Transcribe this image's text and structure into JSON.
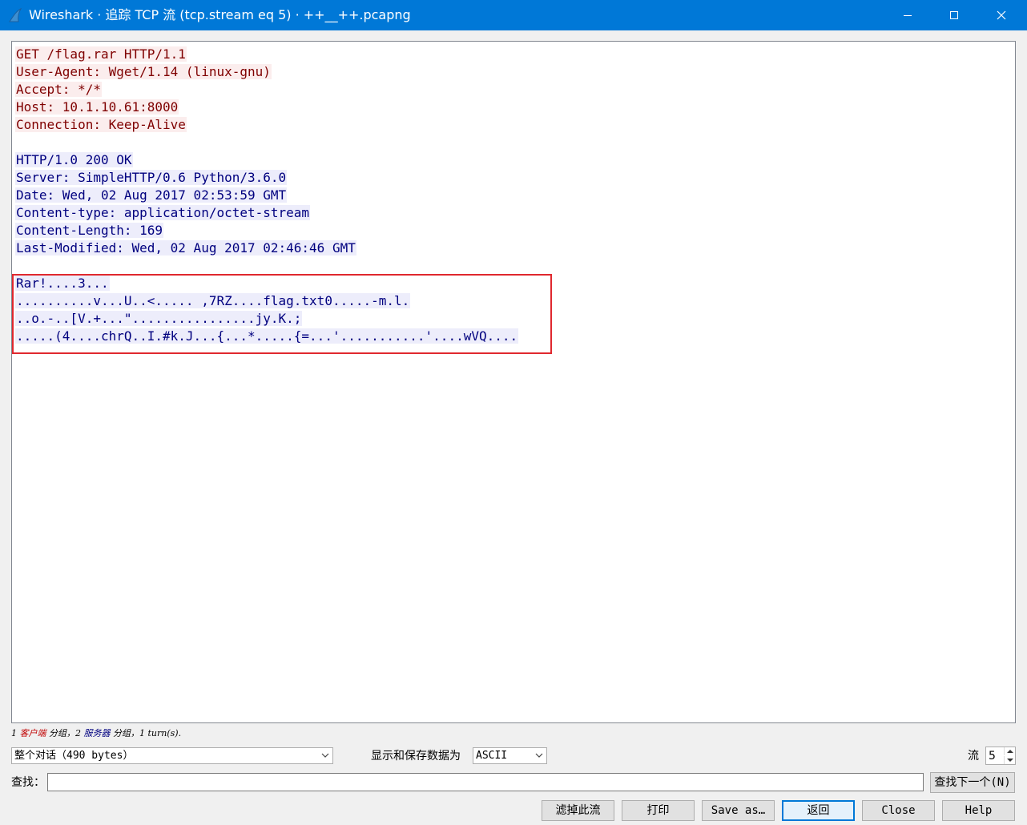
{
  "window": {
    "title": "Wireshark · 追踪 TCP 流 (tcp.stream eq 5) · ++__++.pcapng",
    "icon": "wireshark-fin-icon",
    "controls": [
      "minimize-icon",
      "maximize-icon",
      "close-icon"
    ]
  },
  "stream": {
    "client_lines": [
      "GET /flag.rar HTTP/1.1",
      "User-Agent: Wget/1.14 (linux-gnu)",
      "Accept: */*",
      "Host: 10.1.10.61:8000",
      "Connection: Keep-Alive"
    ],
    "server_header_lines": [
      "HTTP/1.0 200 OK",
      "Server: SimpleHTTP/0.6 Python/3.6.0",
      "Date: Wed, 02 Aug 2017 02:53:59 GMT",
      "Content-type: application/octet-stream",
      "Content-Length: 169",
      "Last-Modified: Wed, 02 Aug 2017 02:46:46 GMT"
    ],
    "server_body_lines": [
      "Rar!....3...",
      "..........v...U..<..... ,7RZ....flag.txt0.....-m.l.",
      "..o.-..[V.+...\"................jy.K.;",
      ".....(4....chrQ..I.#k.J...{...*.....{=...'...........'....wVQ...."
    ],
    "client_color": "#7f0000",
    "client_bg": "#fbeded",
    "server_color": "#00007f",
    "server_bg": "#ededfb",
    "highlight_color": "#e0282e"
  },
  "summary": {
    "part1": "1 ",
    "client_word": "客户端",
    "part2": " 分组，2 ",
    "server_word": "服务器",
    "part3": " 分组，1 turn(s)."
  },
  "controls": {
    "conversation_select": "整个对话（490 bytes）",
    "format_label": "显示和保存数据为",
    "format_select": "ASCII",
    "stream_label": "流",
    "stream_value": "5",
    "find_label": "查找：",
    "find_value": "",
    "find_next": "查找下一个(N)"
  },
  "buttons": {
    "filter_out": "滤掉此流",
    "print": "打印",
    "save_as": "Save as…",
    "back": "返回",
    "close": "Close",
    "help": "Help"
  }
}
